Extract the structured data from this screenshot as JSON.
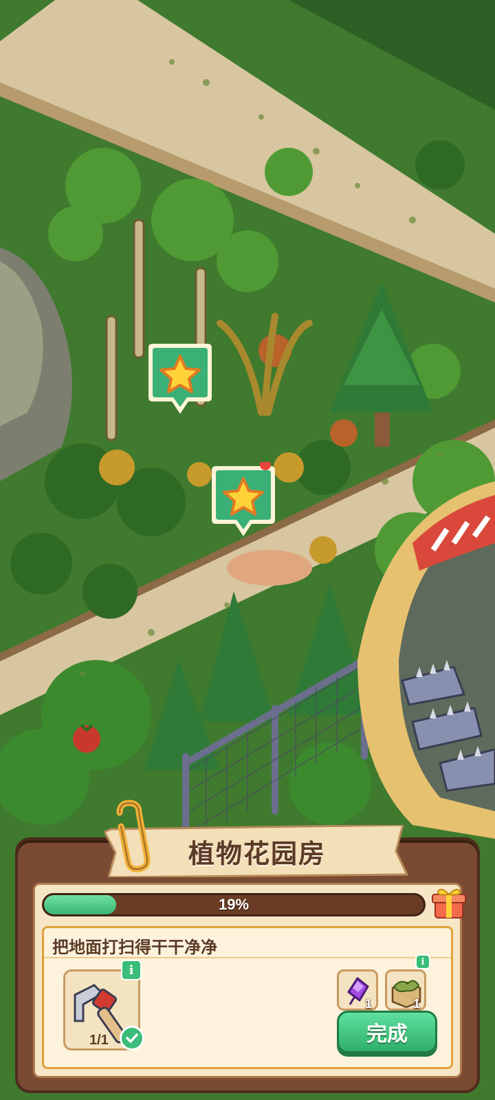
{
  "panel": {
    "title": "植物花园房",
    "progress": {
      "percent": 19,
      "label": "19%"
    },
    "task": {
      "title": "把地面打扫得干干净净",
      "tool_count": "1/1",
      "rewards": [
        {
          "icon": "purple-gem-icon",
          "count": "1"
        },
        {
          "icon": "leaf-box-icon",
          "count": "1"
        }
      ],
      "complete_label": "完成"
    }
  },
  "markers": [
    {
      "icon": "star-icon"
    },
    {
      "icon": "star-icon"
    }
  ],
  "colors": {
    "accent_green": "#3bbd7a",
    "panel_brown": "#7a4b32",
    "panel_cream": "#f6e6c6",
    "grass": "#3f7a2e",
    "path": "#d9c9a0"
  }
}
